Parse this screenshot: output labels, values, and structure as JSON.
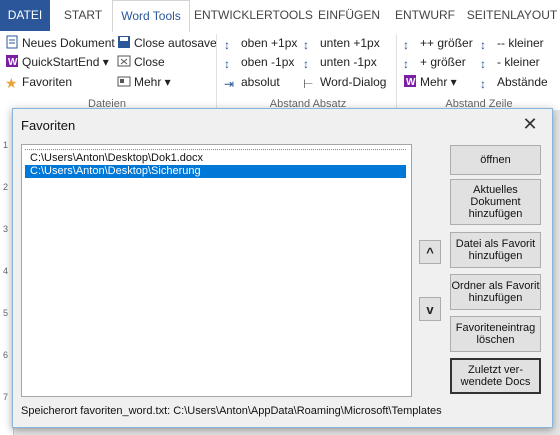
{
  "ribbon": {
    "tabs": [
      "DATEI",
      "START",
      "Word Tools",
      "ENTWICKLERTOOLS",
      "EINFÜGEN",
      "ENTWURF",
      "SEITENLAYOUT"
    ],
    "dateien": {
      "label": "Dateien",
      "items": [
        "Neues Dokument",
        "QuickStartEnd",
        "Favoriten",
        "Close autosave",
        "Close",
        "Mehr"
      ]
    },
    "abstand_absatz": {
      "label": "Abstand Absatz",
      "items": [
        "oben +1px",
        "oben -1px",
        "absolut",
        "unten +1px",
        "unten -1px",
        "Word-Dialog"
      ]
    },
    "abstand_zeile": {
      "label": "Abstand Zeile",
      "items": [
        "++ größer",
        "+ größer",
        "Mehr",
        "-- kleiner",
        "- kleiner",
        "Abstände"
      ]
    }
  },
  "ruler": {
    "numbers": [
      "1",
      "2",
      "3",
      "4",
      "5",
      "6",
      "7"
    ]
  },
  "dialog": {
    "title": "Favoriten",
    "list": [
      "C:\\Users\\Anton\\Desktop\\Dok1.docx",
      "C:\\Users\\Anton\\Desktop\\Sicherung"
    ],
    "selected_index": 1,
    "buttons": {
      "open": "öffnen",
      "add_current": "Aktuelles Dokument hinzufügen",
      "file_as_fav": "Datei  als Favorit hinzufügen",
      "folder_as_fav": "Ordner als Favorit hinzufügen",
      "delete_entry": "Favoriteneintrag löschen",
      "recent_docs": "Zuletzt ver-wendete Docs",
      "up": "^",
      "down": "v"
    },
    "status": "Speicherort favoriten_word.txt:  C:\\Users\\Anton\\AppData\\Roaming\\Microsoft\\Templates"
  }
}
